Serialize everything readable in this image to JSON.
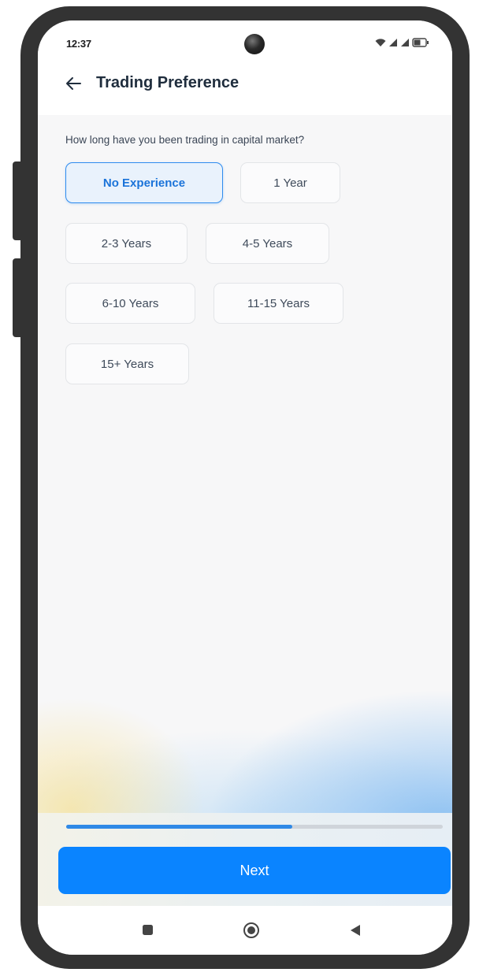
{
  "status_bar": {
    "time": "12:37"
  },
  "header": {
    "title": "Trading Preference"
  },
  "question": "How long have you been trading in capital market?",
  "options": [
    {
      "label": "No Experience",
      "selected": true
    },
    {
      "label": "1 Year",
      "selected": false
    },
    {
      "label": "2-3 Years",
      "selected": false
    },
    {
      "label": "4-5 Years",
      "selected": false
    },
    {
      "label": "6-10 Years",
      "selected": false
    },
    {
      "label": "11-15 Years",
      "selected": false
    },
    {
      "label": "15+ Years",
      "selected": false
    }
  ],
  "progress": {
    "value": 0.6
  },
  "next_button": {
    "label": "Next"
  },
  "colors": {
    "accent": "#0a84ff",
    "selected_text": "#1a73d9",
    "frame": "#333333"
  },
  "icons": {
    "back": "arrow-left-icon",
    "wifi": "wifi-icon",
    "signal": "signal-icon",
    "battery": "battery-icon",
    "nav_recent": "square-icon",
    "nav_home": "circle-icon",
    "nav_back": "triangle-left-icon"
  }
}
